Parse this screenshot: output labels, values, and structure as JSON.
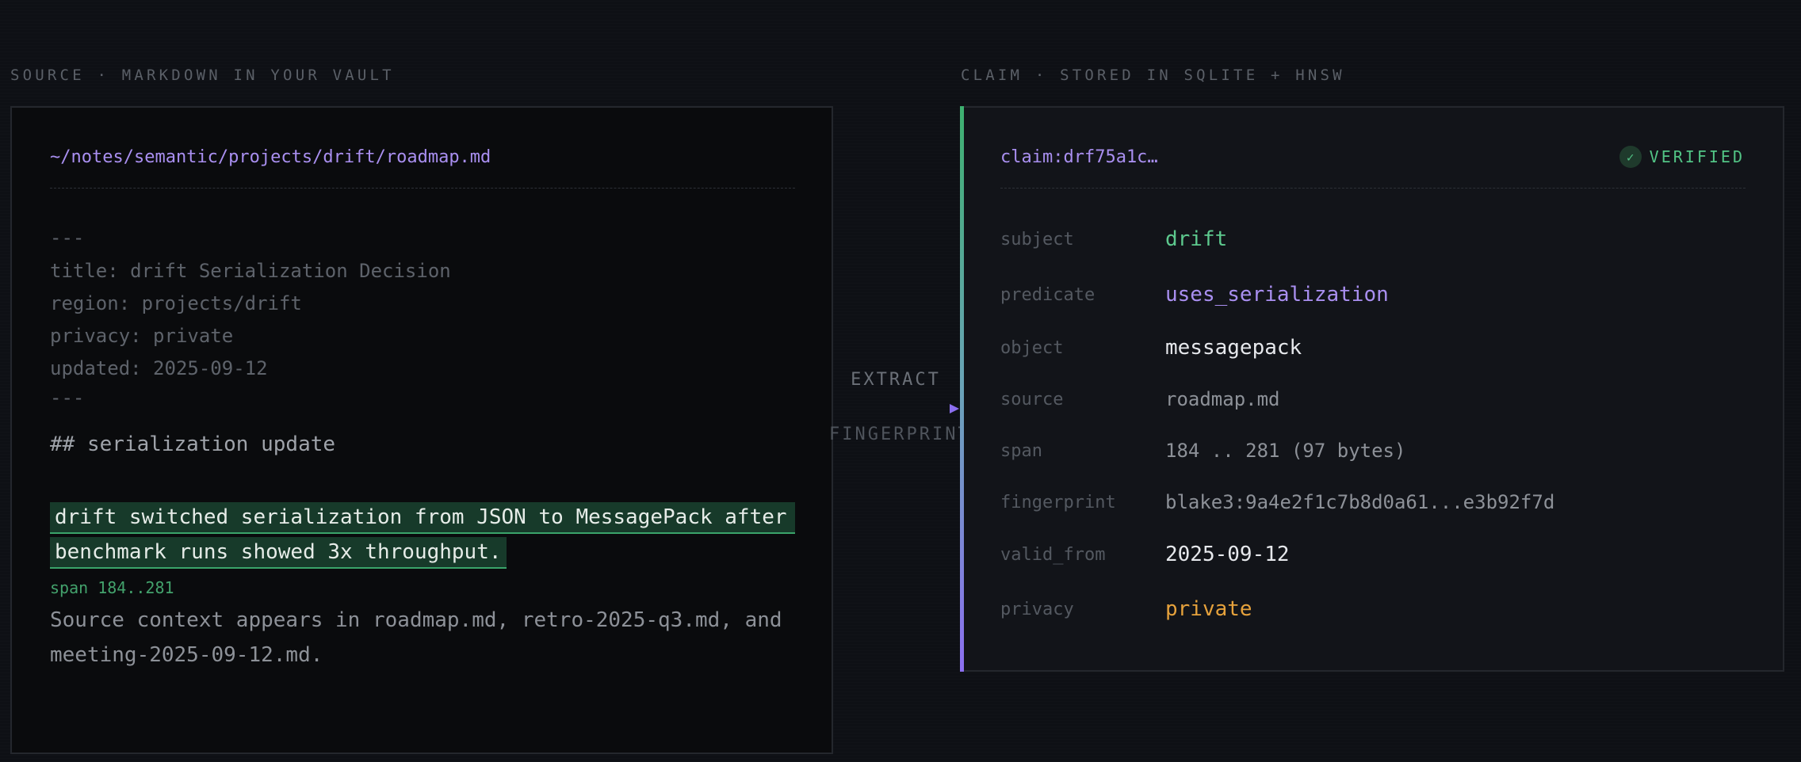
{
  "source": {
    "section_label": "SOURCE · MARKDOWN IN YOUR VAULT",
    "file_path": "~/notes/semantic/projects/drift/roadmap.md",
    "frontmatter": [
      "---",
      "title: drift Serialization Decision",
      "region: projects/drift",
      "privacy: private",
      "updated: 2025-09-12",
      "---"
    ],
    "heading": "## serialization update",
    "highlight_lines": [
      "drift switched serialization from JSON to MessagePack after",
      "benchmark runs showed 3x throughput."
    ],
    "span_tag": "span 184..281",
    "context_lines": [
      "Source context appears in roadmap.md, retro-2025-q3.md, and",
      "meeting-2025-09-12.md."
    ]
  },
  "connector": {
    "top_label": "EXTRACT",
    "bottom_label": "FINGERPRINT"
  },
  "claim": {
    "section_label": "CLAIM · STORED IN SQLITE + HNSW",
    "id": "claim:drf75a1c…",
    "status_icon": "check-icon",
    "status": "VERIFIED",
    "fields": [
      {
        "key": "subject",
        "value": "drift"
      },
      {
        "key": "predicate",
        "value": "uses_serialization"
      },
      {
        "key": "object",
        "value": "messagepack"
      },
      {
        "key": "source",
        "value": "roadmap.md"
      },
      {
        "key": "span",
        "value": "184 .. 281 (97 bytes)"
      },
      {
        "key": "fingerprint",
        "value": "blake3:9a4e2f1c7b8d0a61...e3b92f7d"
      },
      {
        "key": "valid_from",
        "value": "2025-09-12"
      },
      {
        "key": "privacy",
        "value": "private"
      }
    ]
  },
  "colors": {
    "accent_purple": "#a98ff0",
    "accent_green": "#52c485",
    "privacy_orange": "#e6a23c",
    "background": "#0e1015"
  }
}
